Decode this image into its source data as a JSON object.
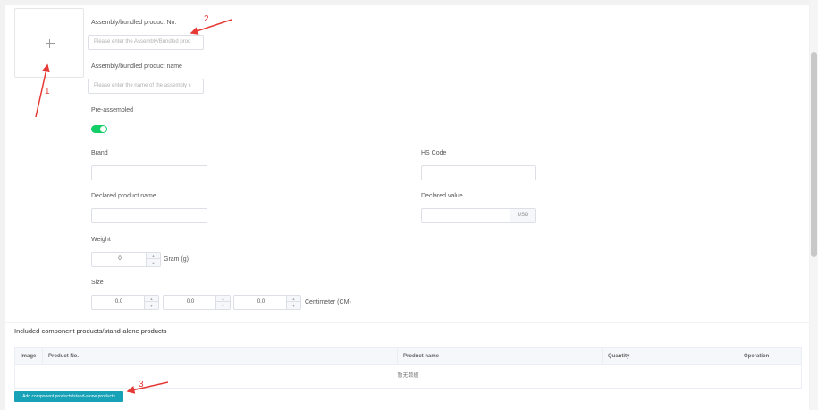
{
  "form": {
    "assembly_no": {
      "label": "Assembly/bundled product No.",
      "placeholder": "Please enter the Assembly/Bundled prod"
    },
    "assembly_name": {
      "label": "Assembly/bundled product name",
      "placeholder": "Please enter the name of the assembly c"
    },
    "pre_assembled": {
      "label": "Pre-assembled",
      "on": true
    },
    "brand": {
      "label": "Brand",
      "value": ""
    },
    "hs_code": {
      "label": "HS Code",
      "value": ""
    },
    "declared_name": {
      "label": "Declared product name",
      "value": ""
    },
    "declared_value": {
      "label": "Declared value",
      "value": "",
      "unit": "USD"
    },
    "weight": {
      "label": "Weight",
      "value": "0",
      "unit": "Gram (g)"
    },
    "size": {
      "label": "Size",
      "length": "0.0",
      "width": "0.0",
      "height": "0.0",
      "unit": "Centimeter (CM)"
    }
  },
  "components": {
    "title": "Included component products/stand-alone products",
    "columns": [
      "Image",
      "Product No.",
      "Product name",
      "Quantity",
      "Operation"
    ],
    "empty_text": "暂无数据",
    "add_button": "Add component products/stand-alone products"
  },
  "annotations": [
    "1",
    "2",
    "3"
  ],
  "colors": {
    "toggle_on": "#13ce66",
    "button": "#17a2b8",
    "annotation": "#e53935"
  }
}
